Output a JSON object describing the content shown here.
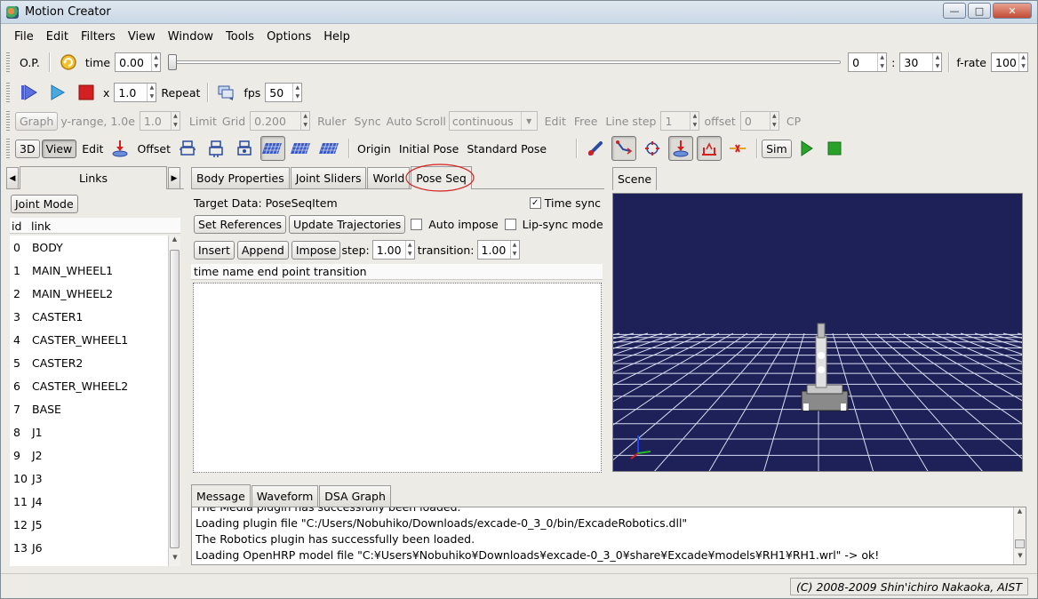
{
  "window": {
    "title": "Motion Creator"
  },
  "menu": [
    "File",
    "Edit",
    "Filters",
    "View",
    "Window",
    "Tools",
    "Options",
    "Help"
  ],
  "toolbar1": {
    "op_label": "O.P.",
    "time_label": "time",
    "time_value": "0.00",
    "range_start": "0",
    "range_sep": ":",
    "range_end": "30",
    "frate_label": "f-rate",
    "frate_value": "100"
  },
  "toolbar2": {
    "speed_prefix": "x",
    "speed_value": "1.0",
    "repeat_label": "Repeat",
    "fps_label": "fps",
    "fps_value": "50"
  },
  "toolbar3": {
    "graph_label": "Graph",
    "yrange_label": "y-range, 1.0e",
    "yrange_value": "1.0",
    "limit_label": "Limit",
    "grid_label": "Grid",
    "grid_value": "0.200",
    "ruler_label": "Ruler",
    "sync_label": "Sync",
    "autoscroll_label": "Auto Scroll",
    "autoscroll_value": "continuous",
    "edit_label": "Edit",
    "free_label": "Free",
    "linestep_label": "Line step",
    "linestep_value": "1",
    "offset_label": "offset",
    "offset_value": "0",
    "cp_label": "CP"
  },
  "toolbar4": {
    "btn_3d": "3D",
    "btn_view": "View",
    "edit_label": "Edit",
    "offset_label": "Offset",
    "origin_label": "Origin",
    "initial_pose_label": "Initial Pose",
    "standard_pose_label": "Standard Pose",
    "sim_label": "Sim"
  },
  "links_panel": {
    "tab": "Links",
    "joint_mode_button": "Joint Mode",
    "col_id": "id",
    "col_link": "link",
    "rows": [
      {
        "id": "0",
        "name": "BODY"
      },
      {
        "id": "1",
        "name": "MAIN_WHEEL1"
      },
      {
        "id": "2",
        "name": "MAIN_WHEEL2"
      },
      {
        "id": "3",
        "name": "CASTER1"
      },
      {
        "id": "4",
        "name": "CASTER_WHEEL1"
      },
      {
        "id": "5",
        "name": "CASTER2"
      },
      {
        "id": "6",
        "name": "CASTER_WHEEL2"
      },
      {
        "id": "7",
        "name": "BASE"
      },
      {
        "id": "8",
        "name": "J1"
      },
      {
        "id": "9",
        "name": "J2"
      },
      {
        "id": "10",
        "name": "J3"
      },
      {
        "id": "11",
        "name": "J4"
      },
      {
        "id": "12",
        "name": "J5"
      },
      {
        "id": "13",
        "name": "J6"
      }
    ]
  },
  "center_panel": {
    "tabs": [
      "Body Properties",
      "Joint Sliders",
      "World",
      "Pose Seq"
    ],
    "target_data": "Target Data: PoseSeqItem",
    "time_sync_label": "Time sync",
    "set_references": "Set References",
    "update_trajectories": "Update Trajectories",
    "auto_impose": "Auto impose",
    "lipsync_mode": "Lip-sync mode",
    "insert": "Insert",
    "append": "Append",
    "impose": "Impose",
    "step_label": "step:",
    "step_value": "1.00",
    "transition_label": "transition:",
    "transition_value": "1.00",
    "list_header": "time name end point transition"
  },
  "scene_panel": {
    "tab": "Scene"
  },
  "message_panel": {
    "tabs": [
      "Message",
      "Waveform",
      "DSA Graph"
    ],
    "lines": [
      "The Media plugin has successfully been loaded.",
      "Loading plugin file \"C:/Users/Nobuhiko/Downloads/excade-0_3_0/bin/ExcadeRobotics.dll\"",
      "The Robotics plugin has successfully been loaded.",
      "Loading OpenHRP model file \"C:¥Users¥Nobuhiko¥Downloads¥excade-0_3_0¥share¥Excade¥models¥RH1¥RH1.wrl\" -> ok!"
    ]
  },
  "status": {
    "copyright": "(C) 2008-2009 Shin'ichiro Nakaoka, AIST"
  },
  "colors": {
    "scene_bg": "#1e2058",
    "highlight_red": "#d42020",
    "stop_red": "#d42020",
    "play_green": "#2aa22a"
  }
}
